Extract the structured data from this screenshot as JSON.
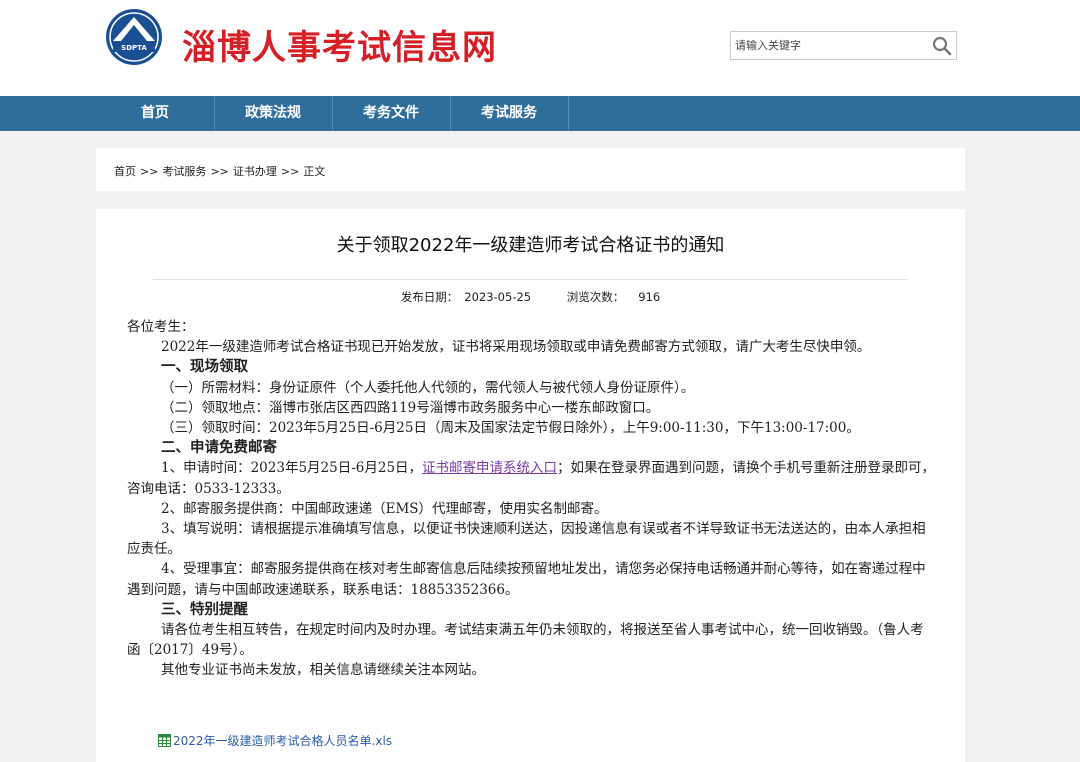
{
  "header": {
    "logo_text": "SDPTA",
    "site_title": "淄博人事考试信息网",
    "search_placeholder": "请输入关键字",
    "logo_color": "#1a4f93",
    "title_color": "#d61f26"
  },
  "nav": {
    "color": "#2f6d9a",
    "items": [
      {
        "label": "首页"
      },
      {
        "label": "政策法规"
      },
      {
        "label": "考务文件"
      },
      {
        "label": "考试服务"
      }
    ]
  },
  "breadcrumb": {
    "items": [
      "首页",
      "考试服务",
      "证书办理",
      "正文"
    ],
    "separator": ">>"
  },
  "article": {
    "title": "关于领取2022年一级建造师考试合格证书的通知",
    "date_label": "发布日期：",
    "date": "2023-05-25",
    "views_label": "浏览次数：",
    "views": "916",
    "greeting": "各位考生：",
    "intro": "2022年一级建造师考试合格证书现已开始发放，证书将采用现场领取或申请免费邮寄方式领取，请广大考生尽快申领。",
    "section1_title": "一、现场领取",
    "s1_p1": "（一）所需材料：身份证原件（个人委托他人代领的，需代领人与被代领人身份证原件）。",
    "s1_p2": "（二）领取地点：淄博市张店区西四路119号淄博市政务服务中心一楼东邮政窗口。",
    "s1_p3": "（三）领取时间：2023年5月25日-6月25日（周末及国家法定节假日除外），上午9:00-11:30，下午13:00-17:00。",
    "section2_title": "二、申请免费邮寄",
    "s2_p1_pre": "1、申请时间：2023年5月25日-6月25日，",
    "s2_p1_link": "证书邮寄申请系统入口",
    "s2_p1_post": "；如果在登录界面遇到问题，请换个手机号重新注册登录即可，咨询电话：0533-12333。",
    "s2_p2": "2、邮寄服务提供商：中国邮政速递（EMS）代理邮寄，使用实名制邮寄。",
    "s2_p3": "3、填写说明：请根据提示准确填写信息，以便证书快速顺利送达，因投递信息有误或者不详导致证书无法送达的，由本人承担相应责任。",
    "s2_p4": "4、受理事宜：邮寄服务提供商在核对考生邮寄信息后陆续按预留地址发出，请您务必保持电话畅通并耐心等待，如在寄递过程中遇到问题，请与中国邮政速递联系，联系电话：18853352366。",
    "section3_title": "三、特别提醒",
    "s3_p1": "请各位考生相互转告，在规定时间内及时办理。考试结束满五年仍未领取的，将报送至省人事考试中心，统一回收销毁。（鲁人考函〔2017〕49号）。",
    "s3_p2": "其他专业证书尚未发放，相关信息请继续关注本网站。",
    "attachment": "2022年一级建造师考试合格人员名单.xls"
  }
}
